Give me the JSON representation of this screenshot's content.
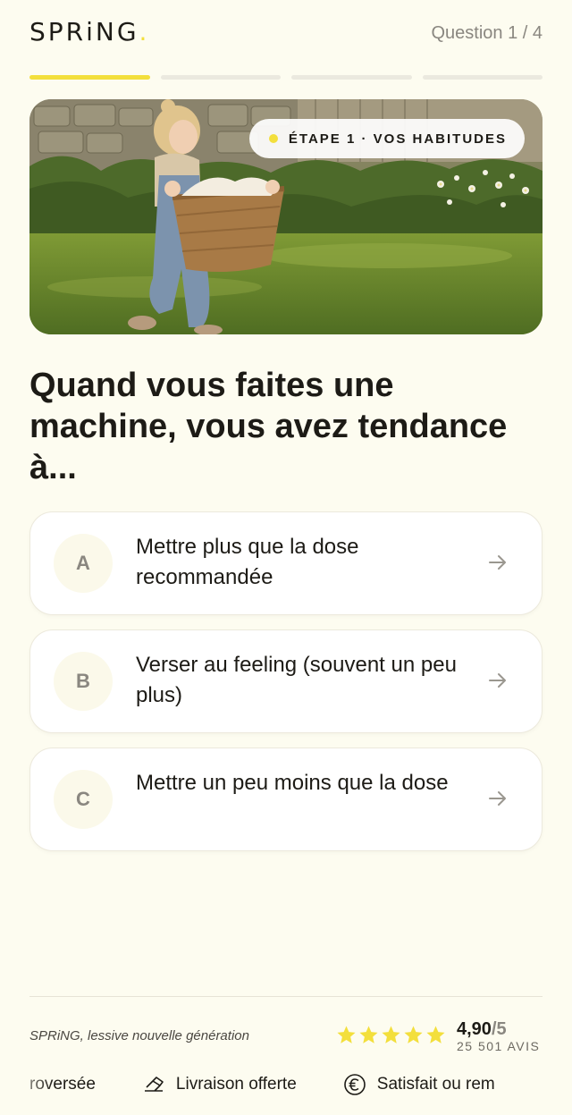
{
  "header": {
    "logo": "SPRiNG",
    "question_counter": "Question 1 / 4"
  },
  "progress": {
    "current": 1,
    "total": 4
  },
  "hero": {
    "step_label": "ÉTAPE 1 · VOS HABITUDES"
  },
  "question": "Quand vous faites une machine, vous avez tendance à...",
  "options": [
    {
      "letter": "A",
      "text": "Mettre plus que la dose recommandée"
    },
    {
      "letter": "B",
      "text": "Verser au feeling (souvent un peu plus)"
    },
    {
      "letter": "C",
      "text": "Mettre un peu moins que la dose"
    }
  ],
  "footer": {
    "tagline": "SPRiNG, lessive nouvelle génération",
    "rating_value": "4,90",
    "rating_suffix": "/5",
    "reviews": "25 501 AVIS",
    "stars": 5,
    "marquee": [
      {
        "icon": "refund-icon",
        "text": "Satisfait ou remboursé"
      },
      {
        "icon": "delivery-icon",
        "text": "Livraison offerte"
      },
      {
        "icon": "euro-circle-icon",
        "text": "Satisfait ou remboursé"
      }
    ],
    "marquee_visible": [
      "roversée",
      "Livraison offerte",
      "Satisfait ou rem"
    ]
  },
  "colors": {
    "background": "#fdfcf0",
    "accent": "#f3df3c",
    "text": "#1d1b16",
    "muted": "#8a8780"
  }
}
